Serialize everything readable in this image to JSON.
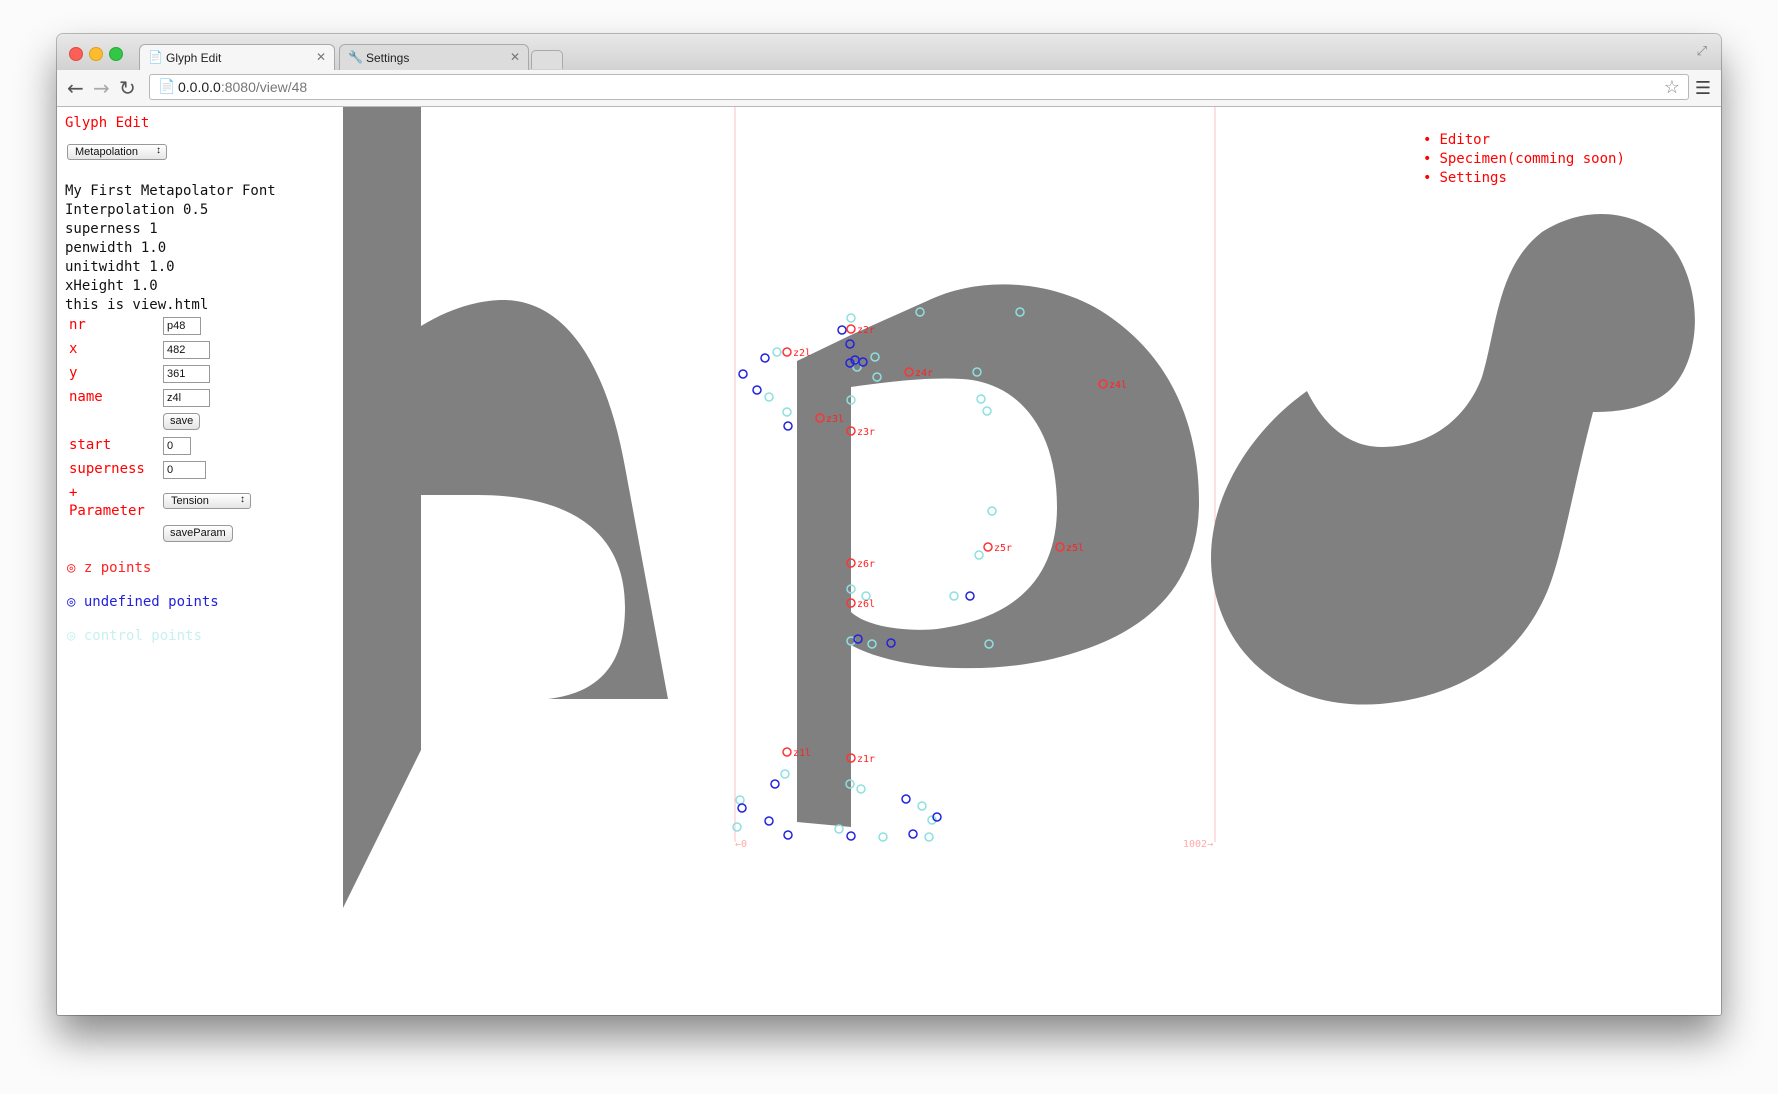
{
  "browser": {
    "tabs": [
      {
        "label": "Glyph Edit",
        "active": true
      },
      {
        "label": "Settings",
        "active": false
      }
    ],
    "url_host": "0.0.0.0",
    "url_rest": ":8080/view/48"
  },
  "sidebar": {
    "title": "Glyph Edit",
    "mode_select": "Metapolation",
    "info_lines": [
      "My First Metapolator Font",
      "Interpolation 0.5",
      "superness 1",
      "penwidth 1.0",
      "unitwidht 1.0",
      "xHeight 1.0",
      "this is view.html"
    ],
    "form": {
      "nr_label": "nr",
      "nr_value": "p48",
      "x_label": "x",
      "x_value": "482",
      "y_label": "y",
      "y_value": "361",
      "name_label": "name",
      "name_value": "z4l",
      "save_label": "save",
      "start_label": "start",
      "start_value": "0",
      "superness_label": "superness",
      "superness_value": "0",
      "plus_label": "+",
      "parameter_label": "Parameter",
      "parameter_select": "Tension",
      "save_param_label": "saveParam"
    },
    "legend": {
      "z_points": "z points",
      "undefined_points": "undefined points",
      "control_points": "control points"
    }
  },
  "nav": {
    "items": [
      "Editor",
      "Specimen(comming soon)",
      "Settings"
    ]
  },
  "canvas": {
    "ruler_start": "←0",
    "ruler_end": "1002→",
    "glyph_fill": "#808080",
    "guide_color": "#ffc0c0",
    "z_point_color": "#ff3333",
    "undefined_point_color": "#2222dd",
    "control_point_color": "#8ee0e0",
    "z_labels": [
      "z2r",
      "z2l",
      "z4r",
      "z4l",
      "z3l",
      "z3r",
      "z5r",
      "z5l",
      "z6r",
      "z6l",
      "z1l",
      "z1r"
    ]
  }
}
